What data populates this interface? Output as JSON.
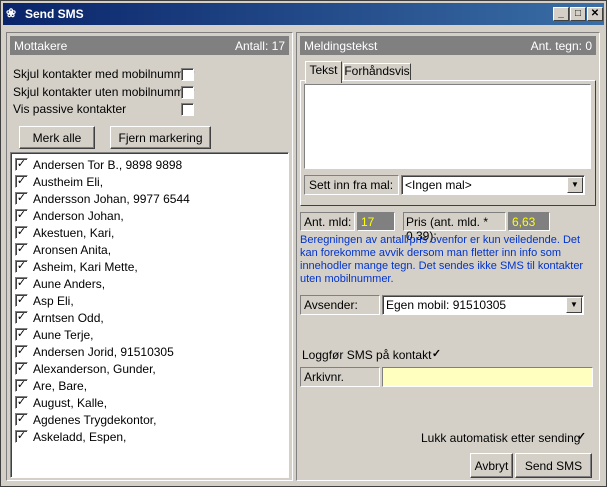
{
  "window": {
    "title": "Send SMS",
    "app_icon": "butterfly-icon"
  },
  "left": {
    "header": "Mottakere",
    "count": "Antall: 17",
    "options": [
      {
        "label": "Skjul kontakter med mobilnummer",
        "checked": false
      },
      {
        "label": "Skjul kontakter uten mobilnummer",
        "checked": false
      },
      {
        "label": "Vis passive kontakter",
        "checked": false
      }
    ],
    "select_all": "Merk alle",
    "clear": "Fjern markering",
    "contacts": [
      "Andersen Tor B., 9898 9898",
      "Austheim Eli,",
      "Andersson Johan, 9977 6544",
      "Anderson Johan,",
      "Akestuen, Kari,",
      "Aronsen Anita,",
      "Asheim, Kari Mette,",
      "Aune Anders,",
      "Asp Eli,",
      "Arntsen Odd,",
      "Aune Terje,",
      "Andersen Jorid, 91510305",
      "Alexanderson, Gunder,",
      "Are, Bare,",
      "August, Kalle,",
      "Agdenes Trygdekontor,",
      "Askeladd, Espen,"
    ]
  },
  "right": {
    "header": "Meldingstekst",
    "count": "Ant. tegn: 0",
    "tabs": [
      "Tekst",
      "Forhåndsvis"
    ],
    "template_label": "Sett inn fra mal:",
    "template_value": "<Ingen mal>",
    "ant_mld_label": "Ant. mld:",
    "ant_mld_value": "17",
    "pris_label": "Pris (ant. mld. * 0,39):",
    "pris_value": "6,63",
    "info": "Beregningen av antall/pris ovenfor er kun veiledende. Det kan forekomme avvik dersom man fletter inn info som innehodler mange tegn. Det sendes ikke SMS til kontakter uten mobilnummer.",
    "sender_label": "Avsender:",
    "sender_value": "Egen mobil: 91510305",
    "log_label": "Loggfør SMS på kontakt",
    "archive_label": "Arkivnr.",
    "autoclose_label": "Lukk automatisk etter sending",
    "cancel": "Avbryt",
    "send": "Send SMS"
  }
}
